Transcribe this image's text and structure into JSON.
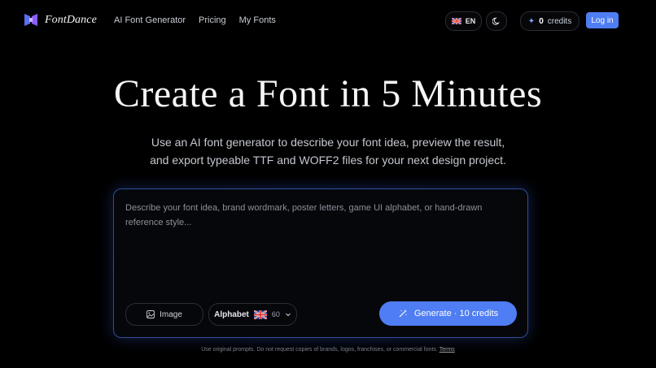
{
  "nav": {
    "brand": "FontDance",
    "links": [
      "AI Font Generator",
      "Pricing",
      "My Fonts"
    ],
    "language": "EN",
    "credits_count": "0",
    "credits_label": "credits",
    "login": "Log in"
  },
  "hero": {
    "title": "Create a Font in 5 Minutes",
    "subtitle_line1": "Use an AI font generator to describe your font idea, preview the result,",
    "subtitle_line2": "and export typeable TTF and WOFF2 files for your next design project."
  },
  "prompt": {
    "placeholder": "Describe your font idea, brand wordmark, poster letters, game UI alphabet, or hand-drawn reference style...",
    "image_button": "Image",
    "alphabet_label": "Alphabet",
    "alphabet_count": "60",
    "generate_button": "Generate · 10 credits"
  },
  "footer": {
    "note": "Use original prompts. Do not request copies of brands, logos, franchises, or commercial fonts.",
    "terms": "Terms"
  },
  "colors": {
    "accent": "#4f7df3",
    "background": "#000000",
    "border_glow": "#2f4d9a"
  },
  "icons": [
    "fontdance-logo-icon",
    "uk-flag-icon",
    "moon-icon",
    "sparkle-icon",
    "image-icon",
    "chevron-down-icon",
    "magic-wand-icon"
  ]
}
